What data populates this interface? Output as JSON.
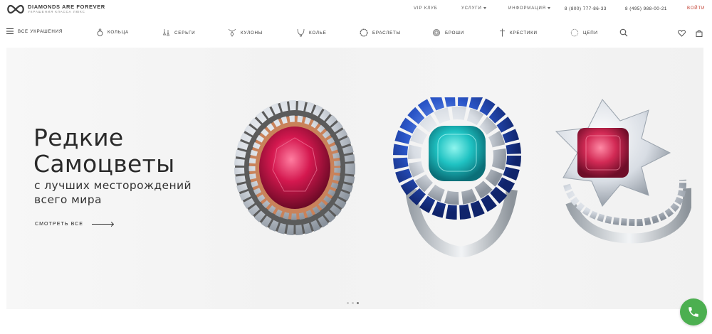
{
  "brand": {
    "name": "DIAMONDS ARE FOREVER",
    "tagline": "УКРАШЕНИЯ КЛАССА ЛЮКС",
    "logo_icon": "infinity-icon"
  },
  "topbar": {
    "links": [
      {
        "label": "VIP КЛУБ",
        "has_dropdown": false
      },
      {
        "label": "УСЛУГИ",
        "has_dropdown": true
      },
      {
        "label": "ИНФОРМАЦИЯ",
        "has_dropdown": true
      }
    ],
    "phones": [
      "8 (800) 777-86-33",
      "8 (495) 988-00-21"
    ],
    "login_label": "ВОЙТИ",
    "login_color": "#c0392b"
  },
  "nav": {
    "menu_label": "ВСЕ УКРАШЕНИЯ",
    "items": [
      {
        "label": "КОЛЬЦА",
        "icon": "ring-icon"
      },
      {
        "label": "СЕРЬГИ",
        "icon": "earrings-icon"
      },
      {
        "label": "КУЛОНЫ",
        "icon": "pendant-icon"
      },
      {
        "label": "КОЛЬЕ",
        "icon": "necklace-icon"
      },
      {
        "label": "БРАСЛЕТЫ",
        "icon": "bracelet-icon"
      },
      {
        "label": "БРОШИ",
        "icon": "brooch-icon"
      },
      {
        "label": "КРЕСТИКИ",
        "icon": "cross-icon"
      },
      {
        "label": "ЦЕПИ",
        "icon": "chain-icon"
      }
    ],
    "action_icons": [
      "search-icon",
      "heart-icon",
      "bag-icon"
    ]
  },
  "hero": {
    "title_line1": "Редкие",
    "title_line2": "Самоцветы",
    "subtitle_line1": "с лучших месторождений",
    "subtitle_line2": "всего мира",
    "cta_label": "СМОТРЕТЬ ВСЕ",
    "slides_count": 3,
    "active_slide": 3,
    "gem_colors": {
      "ruby": "#d4184f",
      "paraiba": "#1fc2c2",
      "sapphire": "#2a55c8",
      "diamond": "#e9edf2",
      "spinel": "#d22a55"
    }
  },
  "call_button": {
    "icon": "phone-icon",
    "color": "#4caf50"
  }
}
